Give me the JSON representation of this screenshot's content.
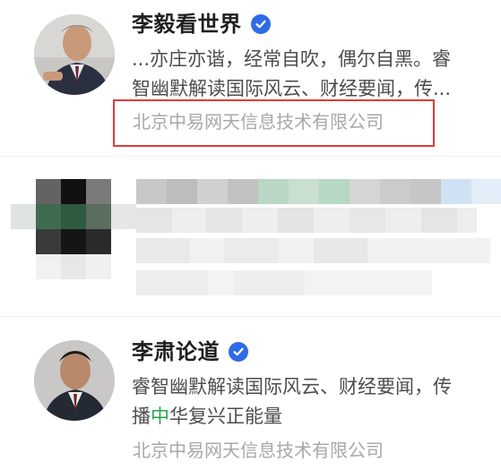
{
  "items": [
    {
      "name": "李毅看世界",
      "description_line1": "...亦庄亦谐，经常自吹，偶尔自黑。睿",
      "description_line2": "智幽默解读国际风云、财经要闻，传...",
      "company": "北京中易网天信息技术有限公司",
      "verified": true
    },
    {
      "name": "李肃论道",
      "description_line1": "睿智幽默解读国际风云、财经要闻，传",
      "description_line2_pre": "播",
      "description_line2_green": "中",
      "description_line2_post": "华复兴正能量",
      "company": "北京中易网天信息技术有限公司",
      "verified": true
    }
  ],
  "colors": {
    "verified": "#2f6be6",
    "highlight_border": "#e23a3a",
    "green_text": "#2aa54a"
  },
  "icons": {
    "verified": "verified-check-icon"
  }
}
